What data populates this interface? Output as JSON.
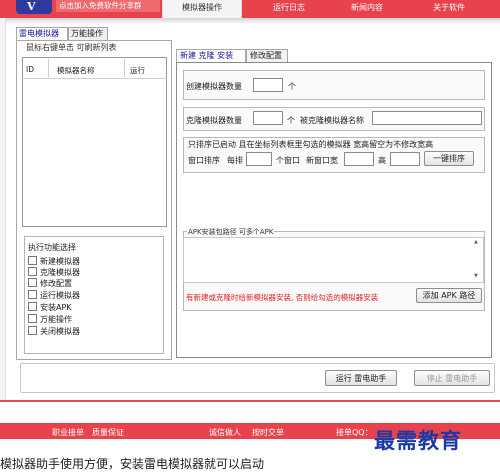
{
  "header": {
    "logo_letter": "V",
    "slogan": "点击加入免费软件分享群",
    "tabs": [
      {
        "label": "模拟器操作",
        "active": true
      },
      {
        "label": "运行日志"
      },
      {
        "label": "新闻内容"
      },
      {
        "label": "关于软件"
      }
    ]
  },
  "left_tabs": [
    {
      "label": "雷电模拟器",
      "active": true
    },
    {
      "label": "万能操作"
    }
  ],
  "list": {
    "hint": "鼠标右键单击 可刷新列表",
    "columns": [
      "ID",
      "模拟器名称",
      "运行"
    ]
  },
  "functions": {
    "title": "执行功能选择",
    "items": [
      "新建模拟器",
      "克隆模拟器",
      "修改配置",
      "运行模拟器",
      "安装APK",
      "万能操作",
      "关闭模拟器"
    ]
  },
  "right_tabs": [
    {
      "label": "新建 克隆 安装",
      "active": true
    },
    {
      "label": "修改配置"
    }
  ],
  "create": {
    "label": "创建模拟器数量",
    "value": "",
    "unit": "个"
  },
  "clone": {
    "label": "克隆模拟器数量",
    "value": "",
    "unit": "个",
    "name_label": "被克隆模拟器名称",
    "name_value": ""
  },
  "sort": {
    "note": "只排序已启动 且在坐标列表框里勾选的模拟器 宽高留空为不修改宽高",
    "window_sort": "窗口排序",
    "per_row": "每排",
    "per_row_unit": "个窗口",
    "new_width": "新窗口宽",
    "height": "高",
    "button": "一键排序"
  },
  "apk": {
    "label": "APK安装包路径 可多个APK",
    "warning": "有新建或克隆时给新模拟器安装, 否则给勾选的模拟器安装",
    "add_button": "添加 APK 路径"
  },
  "actions": {
    "run": "运行 雷电助手",
    "stop": "停止 雷电助手"
  },
  "footer": {
    "items": [
      "职业接单",
      "质量保证",
      "诚信做人",
      "按时交单",
      "接单QQ："
    ]
  },
  "watermark": "最需教育",
  "caption": "模拟器助手使用方便，安装雷电模拟器就可以启动",
  "colors": {
    "brand_red": "#e8434c",
    "logo_blue": "#2f3aa0",
    "warning_red": "#e02020"
  }
}
